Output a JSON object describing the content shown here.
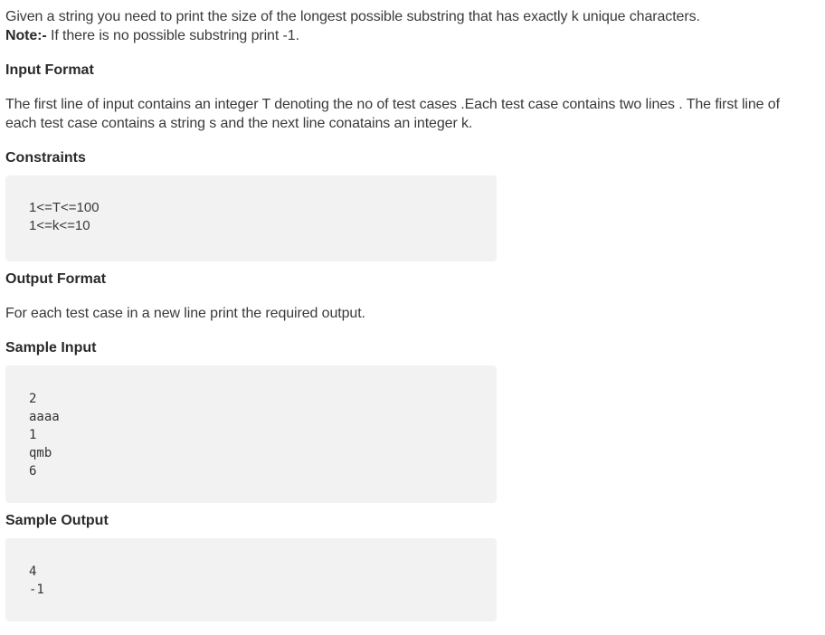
{
  "intro": {
    "line1": "Given a string you need to print the size of the longest possible substring that has exactly k unique characters.",
    "note_label": "Note:-",
    "note_text": " If there is no possible substring print -1."
  },
  "input_format": {
    "heading": "Input Format",
    "text": "The first line of input contains an integer T denoting the no of test cases .Each test case contains two lines . The first line of each test case contains a string s and the next line conatains an integer k."
  },
  "constraints": {
    "heading": "Constraints",
    "lines": [
      "1<=T<=100",
      "1<=k<=10"
    ]
  },
  "output_format": {
    "heading": "Output Format",
    "text": "For each test case in a new line print the required output."
  },
  "sample_input": {
    "heading": "Sample Input",
    "lines": [
      "2",
      "aaaa",
      "1",
      "qmb",
      "6"
    ]
  },
  "sample_output": {
    "heading": "Sample Output",
    "lines": [
      "4",
      "-1"
    ]
  }
}
